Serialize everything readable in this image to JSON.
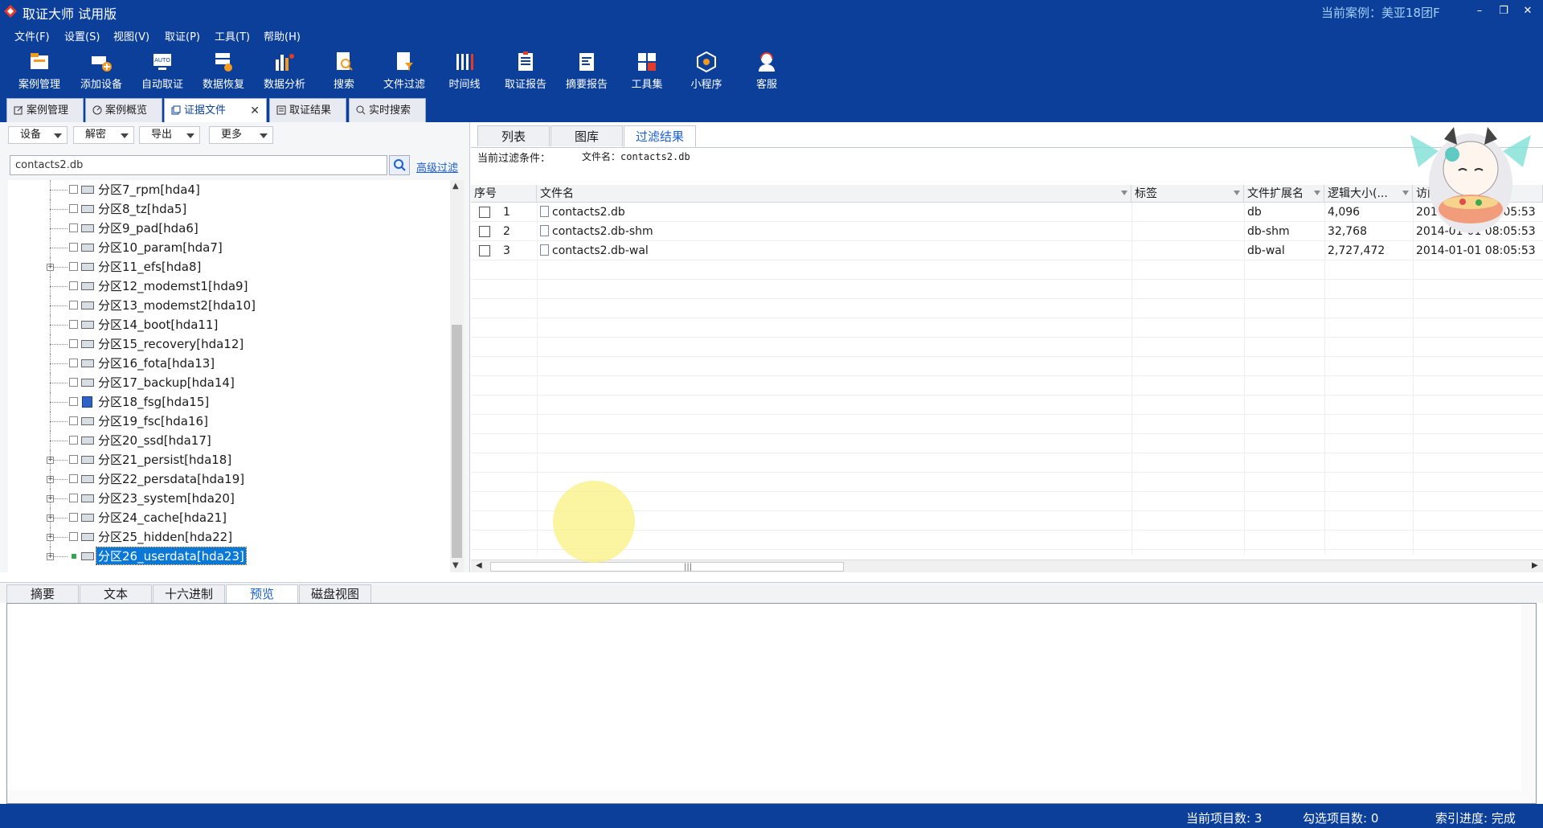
{
  "app": {
    "title": "取证大师 试用版",
    "current_case": "当前案例：美亚18团F",
    "window_buttons": [
      "–",
      "❐",
      "✕"
    ]
  },
  "menu": [
    "文件(F)",
    "设置(S)",
    "视图(V)",
    "取证(P)",
    "工具(T)",
    "帮助(H)"
  ],
  "toolbar": [
    {
      "label": "案例管理",
      "icon": "case-management-icon"
    },
    {
      "label": "添加设备",
      "icon": "add-device-icon"
    },
    {
      "label": "自动取证",
      "icon": "auto-forensics-icon"
    },
    {
      "label": "数据恢复",
      "icon": "data-recovery-icon"
    },
    {
      "label": "数据分析",
      "icon": "data-analysis-icon"
    },
    {
      "label": "搜索",
      "icon": "search-doc-icon"
    },
    {
      "label": "文件过滤",
      "icon": "file-filter-icon"
    },
    {
      "label": "时间线",
      "icon": "timeline-icon"
    },
    {
      "label": "取证报告",
      "icon": "report-icon"
    },
    {
      "label": "摘要报告",
      "icon": "summary-report-icon"
    },
    {
      "label": "工具集",
      "icon": "toolset-icon"
    },
    {
      "label": "小程序",
      "icon": "mini-program-icon"
    },
    {
      "label": "客服",
      "icon": "customer-service-icon"
    }
  ],
  "doc_tabs": [
    {
      "label": "案例管理",
      "active": false
    },
    {
      "label": "案例概览",
      "active": false
    },
    {
      "label": "证据文件",
      "active": true,
      "closable": true
    },
    {
      "label": "取证结果",
      "active": false
    },
    {
      "label": "实时搜索",
      "active": false
    }
  ],
  "left": {
    "dropdowns": [
      "设备",
      "解密",
      "导出",
      "更多"
    ],
    "search_value": "contacts2.db",
    "advanced_filter": "高级过滤",
    "tree": [
      {
        "label": "分区7_rpm[hda4]",
        "expandable": false
      },
      {
        "label": "分区8_tz[hda5]",
        "expandable": false
      },
      {
        "label": "分区9_pad[hda6]",
        "expandable": false
      },
      {
        "label": "分区10_param[hda7]",
        "expandable": false
      },
      {
        "label": "分区11_efs[hda8]",
        "expandable": true
      },
      {
        "label": "分区12_modemst1[hda9]",
        "expandable": false
      },
      {
        "label": "分区13_modemst2[hda10]",
        "expandable": false
      },
      {
        "label": "分区14_boot[hda11]",
        "expandable": false
      },
      {
        "label": "分区15_recovery[hda12]",
        "expandable": false
      },
      {
        "label": "分区16_fota[hda13]",
        "expandable": false
      },
      {
        "label": "分区17_backup[hda14]",
        "expandable": false
      },
      {
        "label": "分区18_fsg[hda15]",
        "expandable": false,
        "special_icon": true
      },
      {
        "label": "分区19_fsc[hda16]",
        "expandable": false
      },
      {
        "label": "分区20_ssd[hda17]",
        "expandable": false
      },
      {
        "label": "分区21_persist[hda18]",
        "expandable": true
      },
      {
        "label": "分区22_persdata[hda19]",
        "expandable": true
      },
      {
        "label": "分区23_system[hda20]",
        "expandable": true
      },
      {
        "label": "分区24_cache[hda21]",
        "expandable": true
      },
      {
        "label": "分区25_hidden[hda22]",
        "expandable": true
      },
      {
        "label": "分区26_userdata[hda23]",
        "expandable": true,
        "selected": true
      }
    ]
  },
  "right": {
    "tabs": [
      {
        "label": "列表",
        "active": false
      },
      {
        "label": "图库",
        "active": false
      },
      {
        "label": "过滤结果",
        "active": true
      }
    ],
    "filter_label": "当前过滤条件：",
    "filter_value": "文件名：contacts2.db",
    "columns": [
      "序号",
      "文件名",
      "标签",
      "文件扩展名",
      "逻辑大小(...",
      "访问时间"
    ],
    "rows": [
      {
        "idx": "1",
        "name": "contacts2.db",
        "tag": "",
        "ext": "db",
        "size": "4,096",
        "time": "2014-01-01 08:05:53"
      },
      {
        "idx": "2",
        "name": "contacts2.db-shm",
        "tag": "",
        "ext": "db-shm",
        "size": "32,768",
        "time": "2014-01-01 08:05:53"
      },
      {
        "idx": "3",
        "name": "contacts2.db-wal",
        "tag": "",
        "ext": "db-wal",
        "size": "2,727,472",
        "time": "2014-01-01 08:05:53"
      }
    ]
  },
  "bottom_tabs": [
    {
      "label": "摘要",
      "active": false
    },
    {
      "label": "文本",
      "active": false
    },
    {
      "label": "十六进制",
      "active": false
    },
    {
      "label": "预览",
      "active": true
    },
    {
      "label": "磁盘视图",
      "active": false
    }
  ],
  "status": {
    "current_items": "当前项目数: 3",
    "checked_items": "勾选项目数: 0",
    "index_progress": "索引进度: 完成"
  }
}
